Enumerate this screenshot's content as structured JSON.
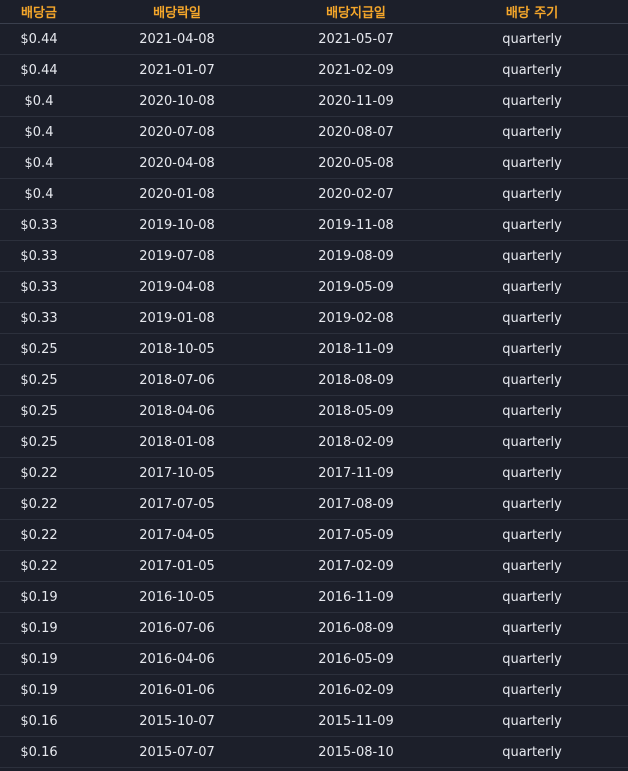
{
  "header": {
    "amount": "배당금",
    "ex_date": "배당락일",
    "pay_date": "배당지급일",
    "frequency": "배당 주기"
  },
  "rows": [
    {
      "amount": "$0.44",
      "ex_date": "2021-04-08",
      "pay_date": "2021-05-07",
      "frequency": "quarterly"
    },
    {
      "amount": "$0.44",
      "ex_date": "2021-01-07",
      "pay_date": "2021-02-09",
      "frequency": "quarterly"
    },
    {
      "amount": "$0.4",
      "ex_date": "2020-10-08",
      "pay_date": "2020-11-09",
      "frequency": "quarterly"
    },
    {
      "amount": "$0.4",
      "ex_date": "2020-07-08",
      "pay_date": "2020-08-07",
      "frequency": "quarterly"
    },
    {
      "amount": "$0.4",
      "ex_date": "2020-04-08",
      "pay_date": "2020-05-08",
      "frequency": "quarterly"
    },
    {
      "amount": "$0.4",
      "ex_date": "2020-01-08",
      "pay_date": "2020-02-07",
      "frequency": "quarterly"
    },
    {
      "amount": "$0.33",
      "ex_date": "2019-10-08",
      "pay_date": "2019-11-08",
      "frequency": "quarterly"
    },
    {
      "amount": "$0.33",
      "ex_date": "2019-07-08",
      "pay_date": "2019-08-09",
      "frequency": "quarterly"
    },
    {
      "amount": "$0.33",
      "ex_date": "2019-04-08",
      "pay_date": "2019-05-09",
      "frequency": "quarterly"
    },
    {
      "amount": "$0.33",
      "ex_date": "2019-01-08",
      "pay_date": "2019-02-08",
      "frequency": "quarterly"
    },
    {
      "amount": "$0.25",
      "ex_date": "2018-10-05",
      "pay_date": "2018-11-09",
      "frequency": "quarterly"
    },
    {
      "amount": "$0.25",
      "ex_date": "2018-07-06",
      "pay_date": "2018-08-09",
      "frequency": "quarterly"
    },
    {
      "amount": "$0.25",
      "ex_date": "2018-04-06",
      "pay_date": "2018-05-09",
      "frequency": "quarterly"
    },
    {
      "amount": "$0.25",
      "ex_date": "2018-01-08",
      "pay_date": "2018-02-09",
      "frequency": "quarterly"
    },
    {
      "amount": "$0.22",
      "ex_date": "2017-10-05",
      "pay_date": "2017-11-09",
      "frequency": "quarterly"
    },
    {
      "amount": "$0.22",
      "ex_date": "2017-07-05",
      "pay_date": "2017-08-09",
      "frequency": "quarterly"
    },
    {
      "amount": "$0.22",
      "ex_date": "2017-04-05",
      "pay_date": "2017-05-09",
      "frequency": "quarterly"
    },
    {
      "amount": "$0.22",
      "ex_date": "2017-01-05",
      "pay_date": "2017-02-09",
      "frequency": "quarterly"
    },
    {
      "amount": "$0.19",
      "ex_date": "2016-10-05",
      "pay_date": "2016-11-09",
      "frequency": "quarterly"
    },
    {
      "amount": "$0.19",
      "ex_date": "2016-07-06",
      "pay_date": "2016-08-09",
      "frequency": "quarterly"
    },
    {
      "amount": "$0.19",
      "ex_date": "2016-04-06",
      "pay_date": "2016-05-09",
      "frequency": "quarterly"
    },
    {
      "amount": "$0.19",
      "ex_date": "2016-01-06",
      "pay_date": "2016-02-09",
      "frequency": "quarterly"
    },
    {
      "amount": "$0.16",
      "ex_date": "2015-10-07",
      "pay_date": "2015-11-09",
      "frequency": "quarterly"
    },
    {
      "amount": "$0.16",
      "ex_date": "2015-07-07",
      "pay_date": "2015-08-10",
      "frequency": "quarterly"
    }
  ],
  "colors": {
    "background": "#1c1f2a",
    "header_text": "#f4a62a",
    "row_text": "#e6e8ee",
    "divider": "#2c303c"
  }
}
